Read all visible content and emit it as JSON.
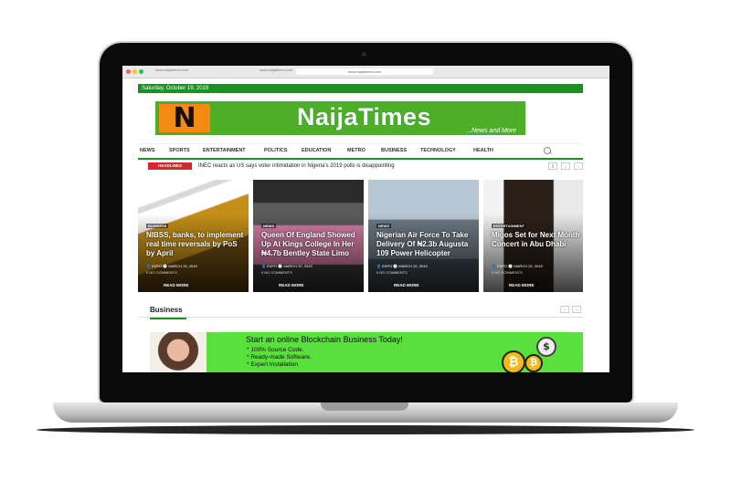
{
  "browser": {
    "tab1": "www.naijatimes.com",
    "tab2": "www.naijatimes.com",
    "url": "www.naijatimes.com"
  },
  "date": "Saturday, October 19, 2019",
  "logo": {
    "letter": "N",
    "title": "NaijaTimes",
    "tagline": "...News and More"
  },
  "nav": [
    "NEWS",
    "SPORTS",
    "ENTERTAINMENT",
    "POLITICS",
    "EDUCATION",
    "METRO",
    "BUSINESS",
    "TECHNOLOGY",
    "HEALTH"
  ],
  "ticker": {
    "label": "HEADLINES",
    "text": "INEC reacts as US says voter intimidation in Nigeria's 2019 polls is disappointing"
  },
  "cards": [
    {
      "category": "BUSINESS",
      "title": "NIBSS, banks, to implement real time reversals by PoS by April",
      "author": "EKPO",
      "date": "MARCH 25, 2019",
      "comments": "0 NO COMMENTS",
      "read_more": "READ MORE"
    },
    {
      "category": "NEWS",
      "title": "Queen Of England Showed Up At Kings College In Her ₦4.7b Bentley State Limo",
      "author": "EKPO",
      "date": "MARCH 22, 2019",
      "comments": "0 NO COMMENTS",
      "read_more": "READ MORE"
    },
    {
      "category": "NEWS",
      "title": "Nigerian Air Force To Take Delivery Of ₦2.3b Augusta 109 Power Helicopter",
      "author": "EKPO",
      "date": "MARCH 22, 2019",
      "comments": "0 NO COMMENTS",
      "read_more": "READ MORE"
    },
    {
      "category": "ENTERTAINMENT",
      "title": "Migos Set for Next Month Concert in Abu Dhabi",
      "author": "EKPO",
      "date": "MARCH 22, 2019",
      "comments": "0 NO COMMENTS",
      "read_more": "READ MORE"
    }
  ],
  "section": {
    "title": "Business"
  },
  "ad": {
    "headline": "Start an online Blockchain Business Today!",
    "lines": [
      "* 100% Source Code.",
      "* Ready-made Software.",
      "* Expert Installation"
    ]
  },
  "colors": {
    "brand_green": "#1e8f25",
    "logo_green": "#4caf27",
    "logo_orange": "#f38a12",
    "headline_red": "#d6262f",
    "ad_green": "#59e03c"
  }
}
